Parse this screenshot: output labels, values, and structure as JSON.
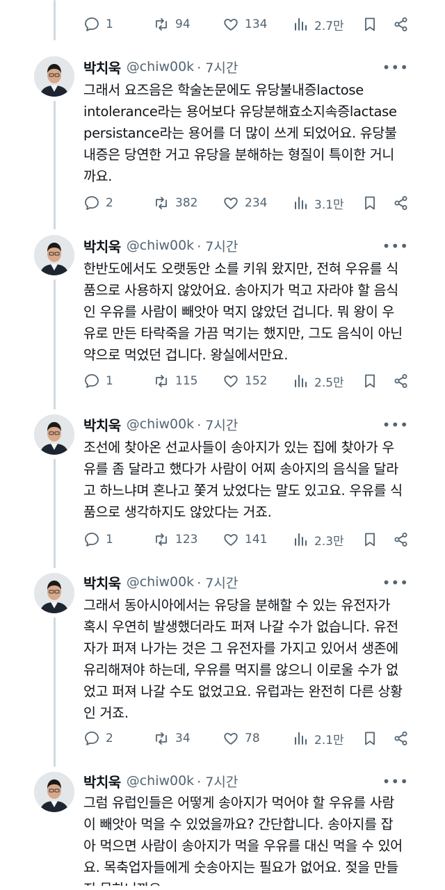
{
  "top_actions": {
    "replies": "1",
    "retweets": "94",
    "likes": "134",
    "views": "2.7만"
  },
  "tweets": [
    {
      "name": "박치욱",
      "handle": "@chiw00k",
      "time": "· 7시간",
      "more": "•••",
      "lines": [
        "그래서 요즈음은 학술논문에도 유당불내증lactose",
        "intolerance라는 용어보다 유당분해효소지속증lactase",
        "persistance라는 용어를 더 많이 쓰게 되었어요. 유당불",
        "내증은 당연한 거고 유당을 분해하는 형질이 특이한 거니",
        "까요."
      ],
      "replies": "2",
      "retweets": "382",
      "likes": "234",
      "views": "3.1만"
    },
    {
      "name": "박치욱",
      "handle": "@chiw00k",
      "time": "· 7시간",
      "more": "•••",
      "lines": [
        "한반도에서도 오랫동안 소를 키워 왔지만, 전혀 우유를 식",
        "품으로 사용하지 않았어요. 송아지가 먹고 자라야 할 음식",
        "인 우유를 사람이 빼앗아 먹지 않았던 겁니다. 뭐 왕이 우",
        "유로 만든 타락죽을 가끔 먹기는 했지만, 그도 음식이 아닌",
        "약으로 먹었던 겁니다. 왕실에서만요."
      ],
      "replies": "1",
      "retweets": "115",
      "likes": "152",
      "views": "2.5만"
    },
    {
      "name": "박치욱",
      "handle": "@chiw00k",
      "time": "· 7시간",
      "more": "•••",
      "lines": [
        "조선에 찾아온 선교사들이 송아지가 있는 집에 찾아가 우",
        "유를 좀 달라고 했다가 사람이 어찌 송아지의 음식을 달라",
        "고 하느냐며 혼나고 쫓겨 났었다는 말도 있고요. 우유를 식",
        "품으로 생각하지도 않았다는 거죠."
      ],
      "replies": "1",
      "retweets": "123",
      "likes": "141",
      "views": "2.3만"
    },
    {
      "name": "박치욱",
      "handle": "@chiw00k",
      "time": "· 7시간",
      "more": "•••",
      "lines": [
        "그래서 동아시아에서는 유당을 분해할 수 있는 유전자가",
        "혹시 우연히 발생했더라도 퍼져 나갈 수가 없습니다. 유전",
        "자가 퍼져 나가는 것은 그 유전자를 가지고 있어서 생존에",
        "유리해져야 하는데, 우유를 먹지를 않으니 이로울 수가 없",
        "었고 퍼져 나갈 수도 없었고요. 유럽과는 완전히 다른 상황",
        "인 거죠."
      ],
      "replies": "2",
      "retweets": "34",
      "likes": "78",
      "views": "2.1만"
    },
    {
      "name": "박치욱",
      "handle": "@chiw00k",
      "time": "· 7시간",
      "more": "•••",
      "lines": [
        "그럼 유럽인들은 어떻게 송아지가 먹어야 할 우유를 사람",
        "이 빼앗아 먹을 수 있었을까요? 간단합니다. 송아지를 잡",
        "아 먹으면 사람이 송아지가 먹을 우유를 대신 먹을 수 있어",
        "요. 목축업자들에게 숫송아지는 필요가 없어요. 젖을 만들",
        "지 못하니까요."
      ]
    }
  ]
}
